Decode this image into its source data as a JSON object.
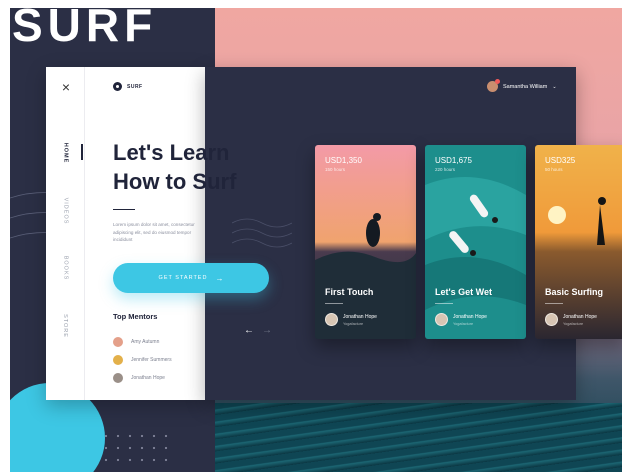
{
  "brand": {
    "hero_word": "SURF",
    "logo_label": "SURF"
  },
  "nav": {
    "close": "×",
    "items": [
      {
        "label": "HOME",
        "active": true
      },
      {
        "label": "VIDEOS",
        "active": false
      },
      {
        "label": "BOOKS",
        "active": false
      },
      {
        "label": "STORE",
        "active": false
      }
    ]
  },
  "hero": {
    "title_line1": "Let's Learn",
    "title_line2": "How to Surf",
    "description": "Lorem ipsum dolor sit amet, consectetur adipiscing elit, sed do eiusmod tempor incididunt",
    "cta_label": "GET STARTED",
    "cta_icon": "→"
  },
  "mentors": {
    "title": "Top Mentors",
    "list": [
      {
        "name": "Amy Autumn",
        "color": "#e4a08a"
      },
      {
        "name": "Jennifer Summers",
        "color": "#e3b04a"
      },
      {
        "name": "Jonathan Hope",
        "color": "#9a8f88"
      }
    ]
  },
  "account": {
    "name": "Samantha William",
    "caret": "⌄"
  },
  "carousel": {
    "prev": "←",
    "next": "→"
  },
  "cards": [
    {
      "price": "USD1,350",
      "hours": "150 hours",
      "title": "First Touch",
      "mentor": "Jonathan Hope",
      "role": "Yogafacture"
    },
    {
      "price": "USD1,675",
      "hours": "220 hours",
      "title": "Let's Get Wet",
      "mentor": "Jonathan Hope",
      "role": "Yogafacture"
    },
    {
      "price": "USD325",
      "hours": "50 hours",
      "title": "Basic Surfing",
      "mentor": "Jonathan Hope",
      "role": "Yogafacture"
    }
  ],
  "colors": {
    "accent": "#3dc7e4",
    "dark": "#2b2f45",
    "ink": "#20243a"
  }
}
